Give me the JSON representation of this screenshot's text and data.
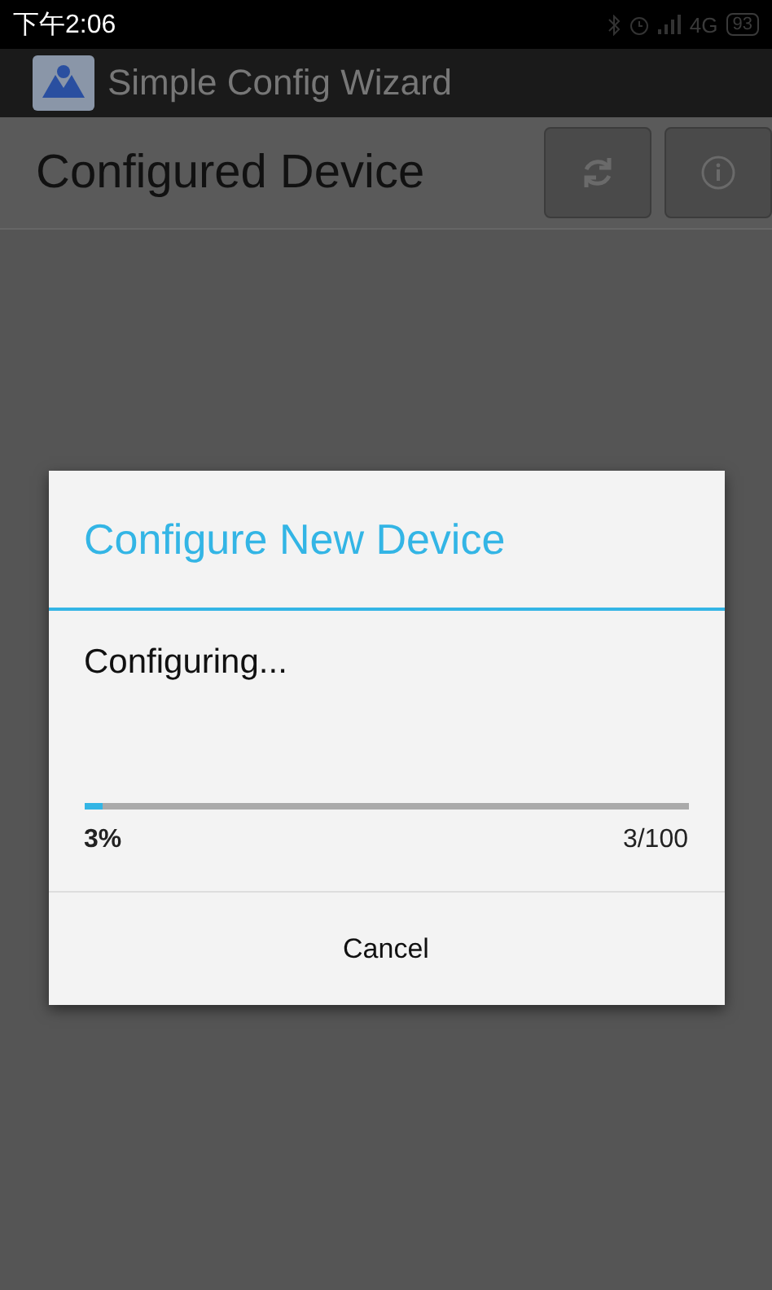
{
  "status_bar": {
    "time": "下午2:06",
    "network": "4G",
    "battery": "93"
  },
  "app_bar": {
    "title": "Simple Config Wizard"
  },
  "action_bar": {
    "title": "Configured Device"
  },
  "dialog": {
    "title": "Configure New Device",
    "message": "Configuring...",
    "progress": {
      "level": 0.03,
      "percent": "3%",
      "count": "3/100"
    },
    "buttons": [
      "Cancel"
    ]
  }
}
